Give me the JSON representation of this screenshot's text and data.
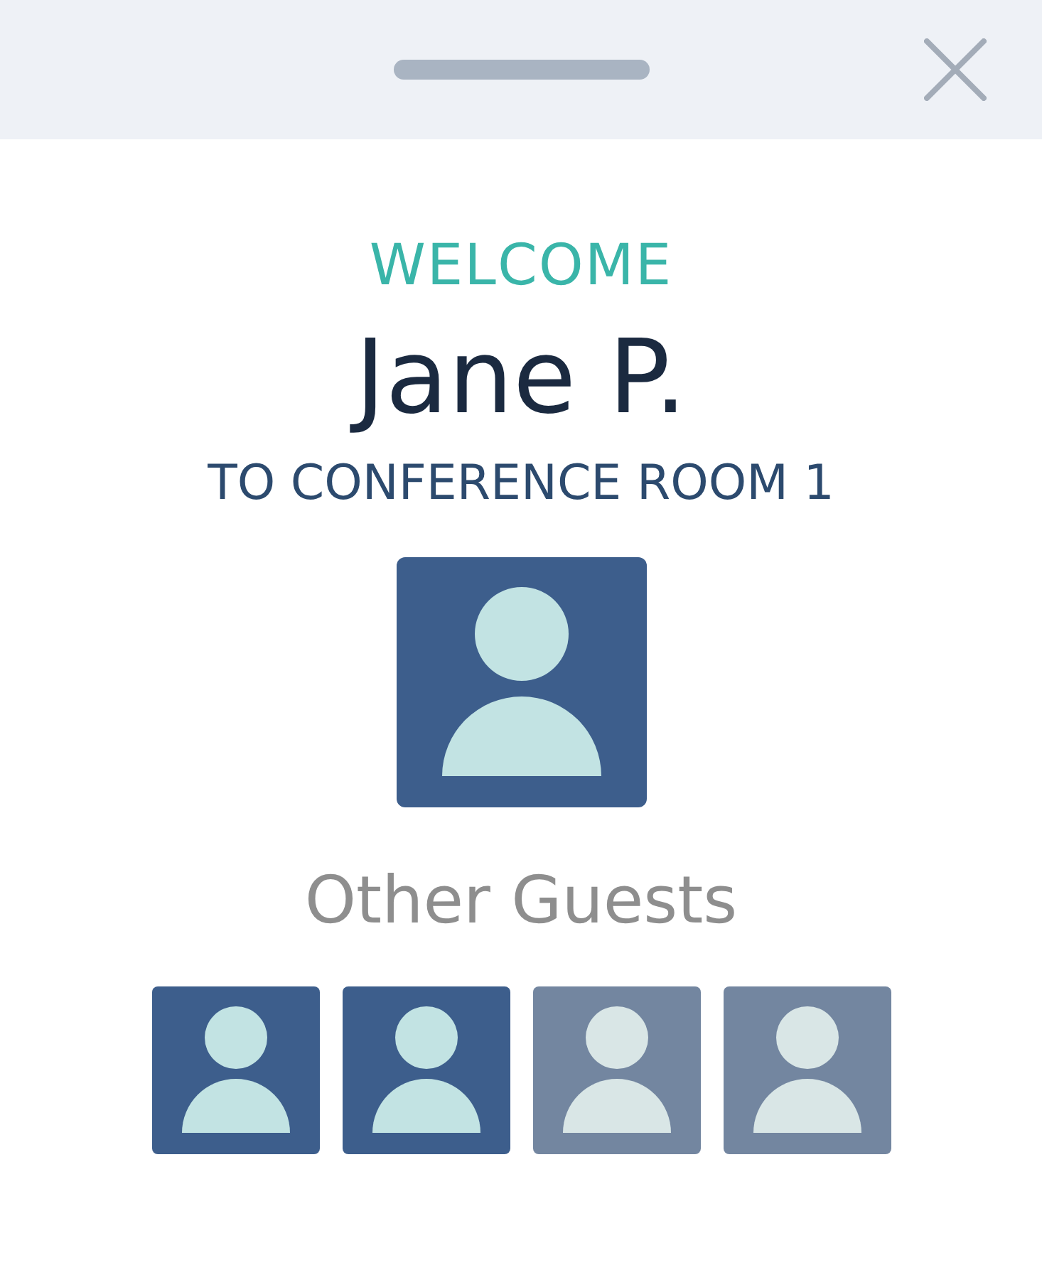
{
  "greeting": {
    "welcome": "WELCOME",
    "name": "Jane P.",
    "destination": "TO CONFERENCE ROOM 1"
  },
  "host": {
    "active": true
  },
  "other_guests": {
    "title": "Other Guests",
    "guests": [
      {
        "active": true
      },
      {
        "active": true
      },
      {
        "active": false
      },
      {
        "active": false
      }
    ]
  }
}
